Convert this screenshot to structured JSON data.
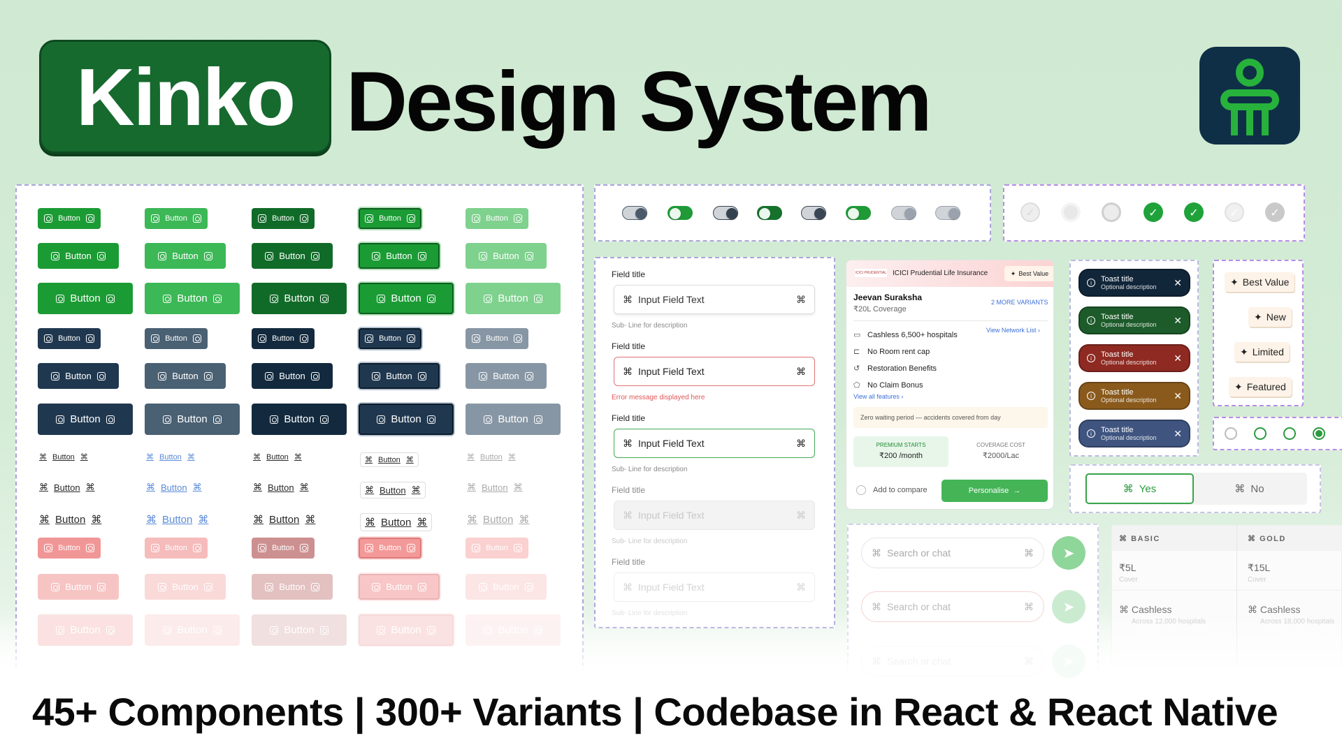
{
  "hero": {
    "logo_text": "Kinko",
    "title": "Design System"
  },
  "colors": {
    "brand": "#166a2e",
    "green": "#1b9b34",
    "navy": "#213a52",
    "slate": "#3e566c",
    "error": "#e45c5c",
    "pink": "#f6b8b8"
  },
  "buttons": {
    "label": "Button"
  },
  "toggles": {
    "count": 8
  },
  "checks": {
    "count": 7
  },
  "fields": {
    "field_title": "Field title",
    "input_text": "Input Field Text",
    "sub_line": "Sub- Line for description",
    "error_message": "Error message displayed here"
  },
  "insurance": {
    "badge": "Best Value",
    "company_logo": "ICICI PRUDENTIAL",
    "company": "ICICI Prudential Life Insurance",
    "plan": "Jeevan Suraksha",
    "coverage": "₹20L Coverage",
    "more_variants": "2 MORE VARIANTS",
    "features": [
      "Cashless 6,500+ hospitals",
      "No Room rent cap",
      "Restoration Benefits",
      "No Claim Bonus"
    ],
    "network_link": "View Network List",
    "all_features_link": "View all features",
    "note": "Zero waiting period — accidents covered from day",
    "premium_label": "PREMIUM STARTS",
    "premium_value": "₹200 /month",
    "cover_label": "COVERAGE COST",
    "cover_value": "₹2000/Lac",
    "compare": "Add to compare",
    "personalise": "Personalise"
  },
  "toasts": {
    "title": "Toast title",
    "desc": "Optional description"
  },
  "tags": [
    "Best Value",
    "New",
    "Limited",
    "Featured"
  ],
  "segmented": {
    "yes": "Yes",
    "no": "No"
  },
  "search": {
    "placeholder": "Search or chat"
  },
  "plans": {
    "basic": {
      "name": "BASIC",
      "price": "₹5L",
      "cover": "Cover",
      "feature": "Cashless",
      "detail": "Across 12,000 hospitals"
    },
    "gold": {
      "name": "GOLD",
      "price": "₹15L",
      "cover": "Cover",
      "feature": "Cashless",
      "detail": "Across 18,000 hospitals"
    }
  },
  "footer": {
    "tagline": "45+ Components | 300+ Variants | Codebase in React & React Native"
  }
}
